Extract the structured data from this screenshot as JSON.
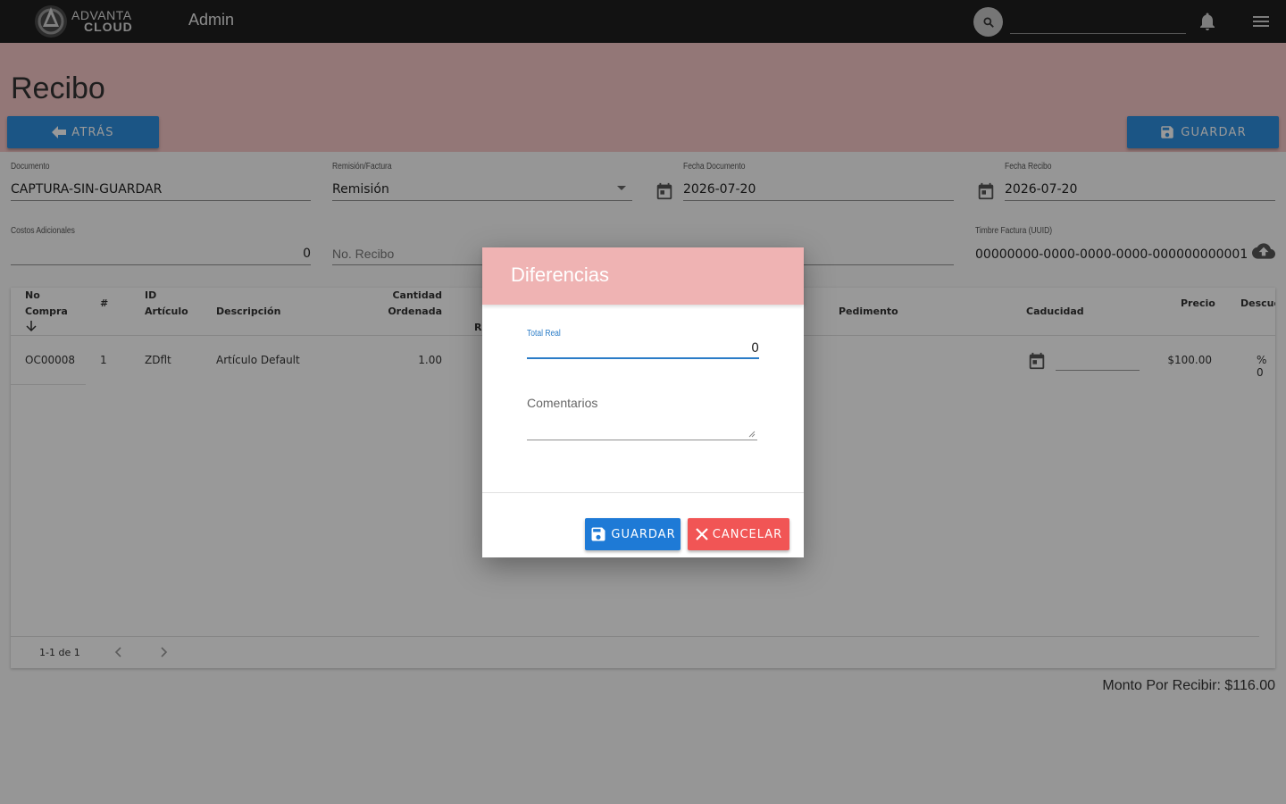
{
  "topbar": {
    "logo_line1": "ADVANTA",
    "logo_line2": "CLOUD",
    "app_title": "Admin",
    "search_placeholder": ""
  },
  "page": {
    "title": "Recibo",
    "back_label": "ATRÁS",
    "save_label": "GUARDAR"
  },
  "form": {
    "documento": {
      "label": "Documento",
      "value": "CAPTURA-SIN-GUARDAR"
    },
    "remision": {
      "label": "Remisión/Factura",
      "value": "Remisión"
    },
    "fecha_documento": {
      "label": "Fecha Documento",
      "value": "2026-07-20"
    },
    "fecha_recibo": {
      "label": "Fecha Recibo",
      "value": "2026-07-20"
    },
    "costos": {
      "label": "Costos Adicionales",
      "value": "0"
    },
    "no_recibo": {
      "placeholder": "No. Recibo"
    },
    "timbre": {
      "label": "Timbre Factura (UUID)",
      "value": "00000000-0000-0000-0000-000000000001"
    }
  },
  "table": {
    "headers": {
      "no_compra_1": "No",
      "no_compra_2": "Compra",
      "num": "#",
      "id_1": "ID",
      "id_2": "Artículo",
      "descripcion": "Descripción",
      "cantidad_1": "Cantidad",
      "cantidad_2": "Ordenada",
      "recibida_partial": "Re",
      "pedimento": "Pedimento",
      "caducidad": "Caducidad",
      "precio": "Precio",
      "descuento": "Descue"
    },
    "rows": [
      {
        "no_compra": "OC00008",
        "num": "1",
        "id": "ZDflt",
        "descripcion": "Artículo Default",
        "cantidad": "1.00",
        "precio": "$100.00",
        "descuento": "% 0"
      }
    ],
    "pager": "1-1 de 1"
  },
  "summary": {
    "monto": "Monto Por Recibir: $116.00"
  },
  "dialog": {
    "title": "Diferencias",
    "total_label": "Total Real",
    "total_value": "0",
    "comments_placeholder": "Comentarios",
    "save_label": "GUARDAR",
    "cancel_label": "CANCELAR"
  },
  "colors": {
    "topbar": "#1e1e1e",
    "header_band": "#f5c6c6",
    "primary": "#2e8ede",
    "danger": "#f15555",
    "dialog_header": "#efb3b3"
  }
}
